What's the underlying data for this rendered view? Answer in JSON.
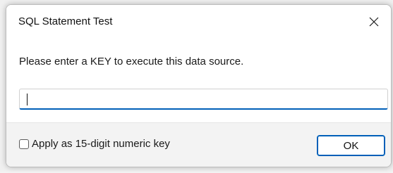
{
  "dialog": {
    "title": "SQL Statement Test",
    "close_icon": "close-icon",
    "prompt": "Please enter a KEY to execute this data source.",
    "key_input": {
      "value": "",
      "placeholder": ""
    },
    "checkbox": {
      "label": "Apply as 15-digit numeric key",
      "checked": false
    },
    "ok_label": "OK"
  },
  "colors": {
    "accent": "#005fb8",
    "footer_bg": "#f3f3f3",
    "dialog_bg": "#ffffff"
  }
}
